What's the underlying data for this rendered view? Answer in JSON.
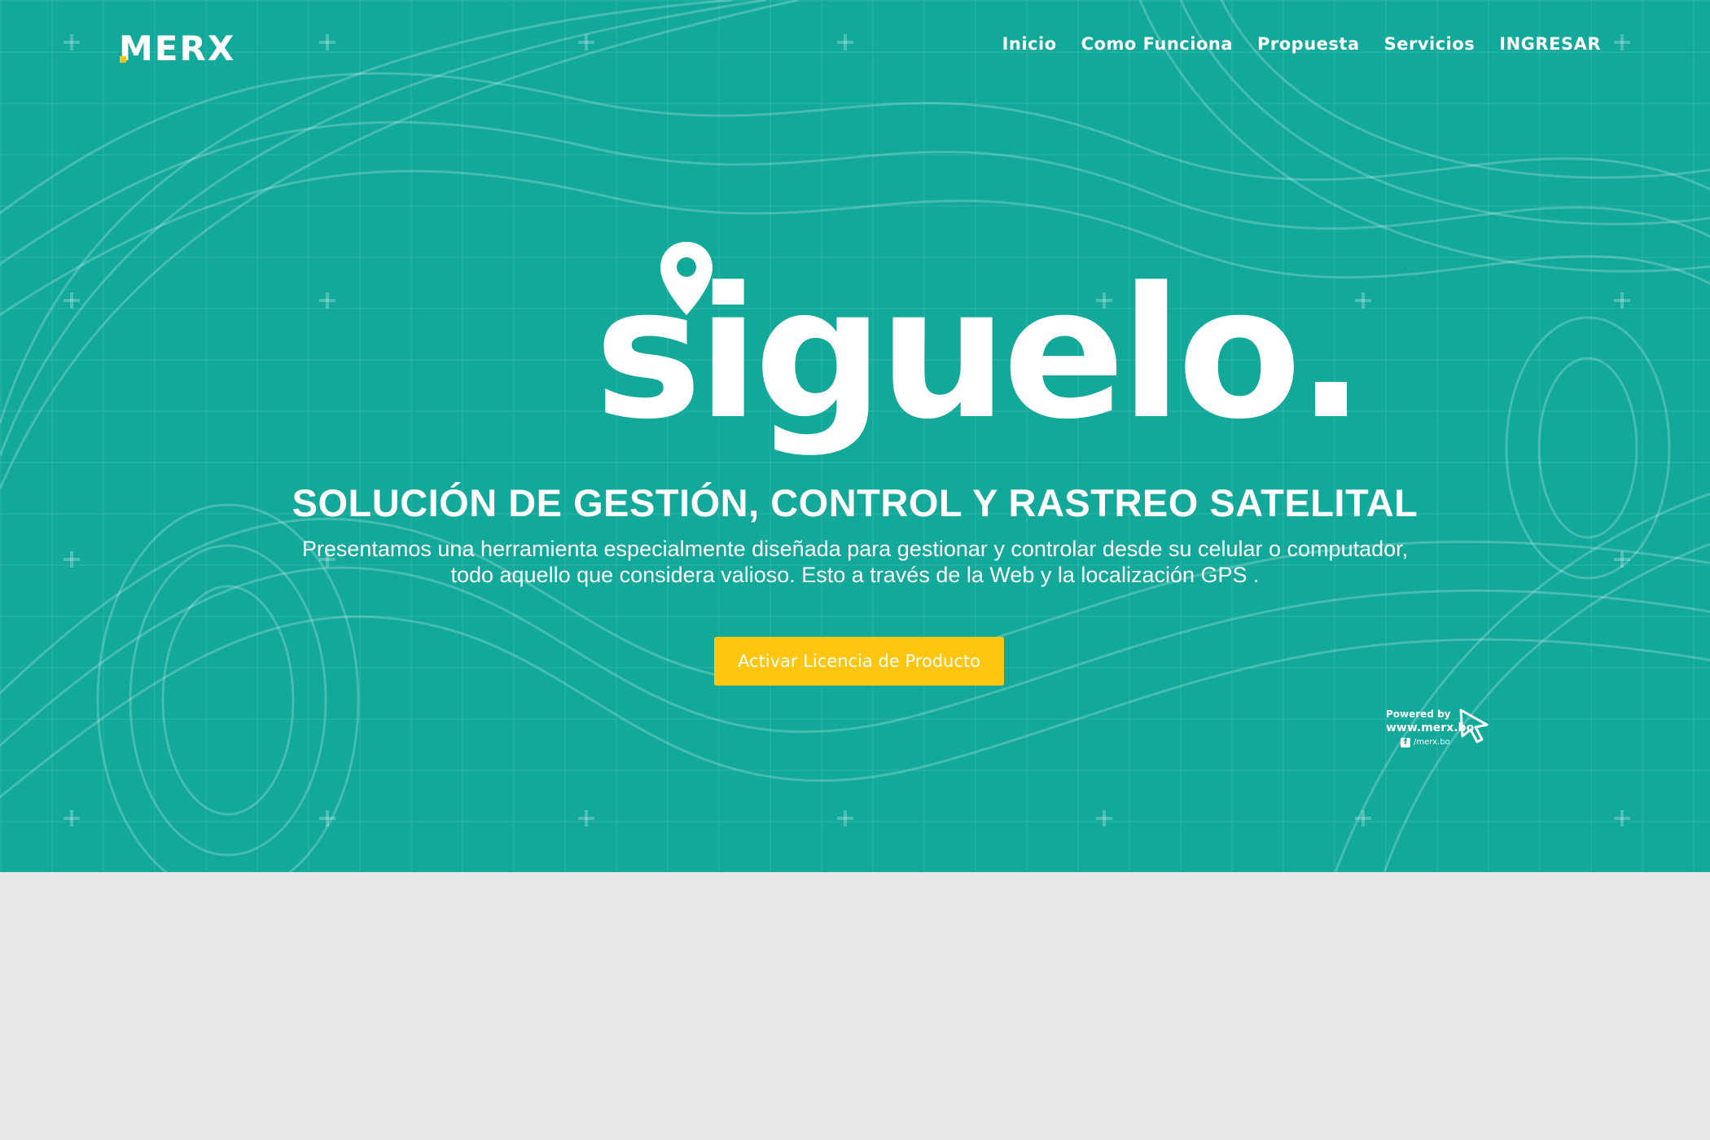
{
  "brand": {
    "logo_text": "MERX",
    "product_name": "siguelo.",
    "accent_color": "#12a99b",
    "button_color": "#fec60f"
  },
  "nav": {
    "items": [
      {
        "label": "Inicio"
      },
      {
        "label": "Como Funciona"
      },
      {
        "label": "Propuesta"
      },
      {
        "label": "Servicios"
      },
      {
        "label": "INGRESAR"
      }
    ]
  },
  "hero": {
    "headline": "SOLUCIÓN DE GESTIÓN, CONTROL Y RASTREO SATELITAL",
    "subtext_line1": "Presentamos una herramienta especialmente diseñada para gestionar y controlar desde su celular o computador,",
    "subtext_line2": "todo aquello que considera valioso. Esto a través de la Web y la localización GPS .",
    "cta_label": "Activar Licencia de Producto"
  },
  "powered": {
    "line1": "Powered by",
    "line2": "www.merx.bo",
    "line3": "/merx.bo",
    "fb_glyph": "f"
  }
}
